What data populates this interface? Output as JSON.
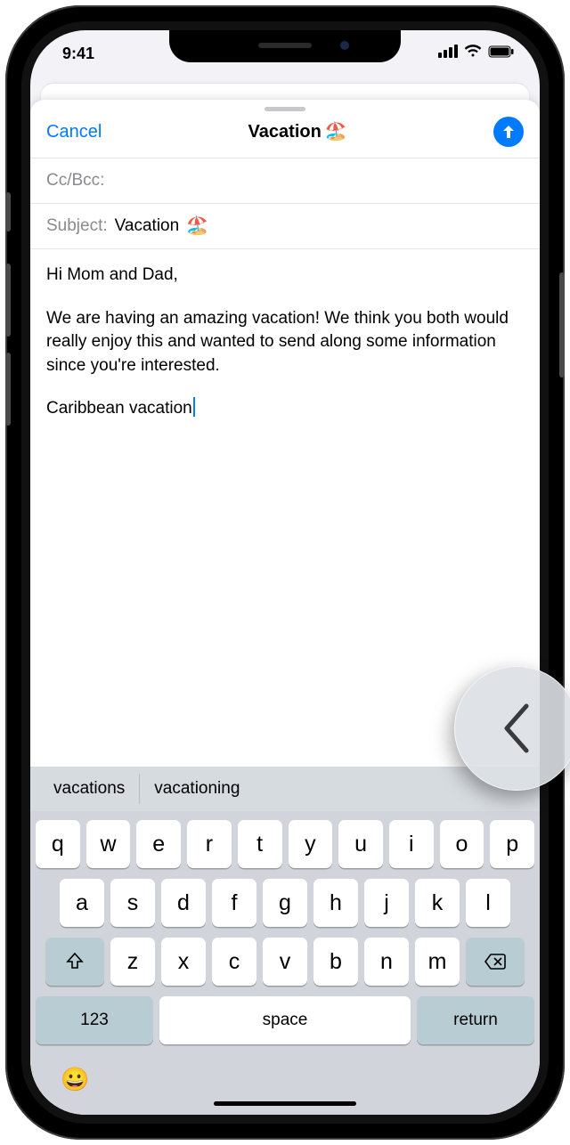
{
  "statusbar": {
    "time": "9:41"
  },
  "compose": {
    "cancel": "Cancel",
    "title": "Vacation",
    "title_emoji": "🏖️",
    "ccbcc_label": "Cc/Bcc:",
    "subject_label": "Subject:",
    "subject_value": "Vacation",
    "body_greeting": "Hi Mom and Dad,",
    "body_para": "We are having an amazing vacation! We think you both would really enjoy this and wanted to send along some information since you're interested.",
    "body_lastline": "Caribbean vacation"
  },
  "keyboard": {
    "suggestions": [
      "vacations",
      "vacationing"
    ],
    "row1": [
      "q",
      "w",
      "e",
      "r",
      "t",
      "y",
      "u",
      "i",
      "o",
      "p"
    ],
    "row2": [
      "a",
      "s",
      "d",
      "f",
      "g",
      "h",
      "j",
      "k",
      "l"
    ],
    "row3": [
      "z",
      "x",
      "c",
      "v",
      "b",
      "n",
      "m"
    ],
    "numkey": "123",
    "space": "space",
    "return": "return"
  },
  "icons": {
    "send": "arrow-up",
    "shift": "shift",
    "backspace": "backspace",
    "emoji": "😀"
  }
}
